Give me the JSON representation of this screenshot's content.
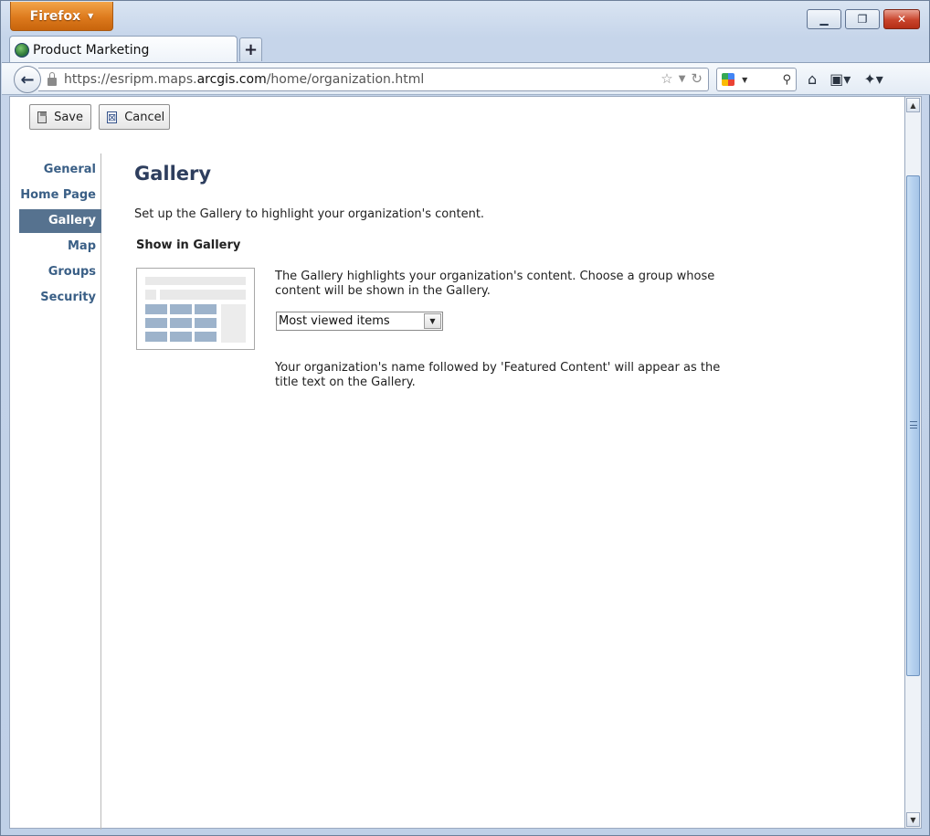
{
  "browser": {
    "menu_label": "Firefox",
    "tab_title": "Product Marketing",
    "new_tab_label": "+",
    "url_prefix": "https://esripm.maps.",
    "url_domain": "arcgis.com",
    "url_path": "/home/organization.html",
    "window_buttons": {
      "minimize": "▭",
      "restore": "□",
      "close": "✕"
    }
  },
  "toolbar": {
    "save_label": "Save",
    "cancel_label": "Cancel"
  },
  "sidebar": {
    "items": [
      {
        "label": "General",
        "active": false
      },
      {
        "label": "Home Page",
        "active": false
      },
      {
        "label": "Gallery",
        "active": true
      },
      {
        "label": "Map",
        "active": false
      },
      {
        "label": "Groups",
        "active": false
      },
      {
        "label": "Security",
        "active": false
      }
    ]
  },
  "main": {
    "title": "Gallery",
    "intro": "Set up the Gallery to highlight your organization's content.",
    "section_heading": "Show in Gallery",
    "description": "The Gallery highlights your organization's content. Choose a group whose content will be shown in the Gallery.",
    "group_select": {
      "selected": "Most viewed items"
    },
    "note": "Your organization's name followed by 'Featured Content' will appear as the title text on the Gallery."
  },
  "colors": {
    "nav_active_bg": "#56728f",
    "nav_text": "#3a5f86",
    "title_text": "#2e3e5e",
    "firefox_orange": "#dd7a1d"
  }
}
